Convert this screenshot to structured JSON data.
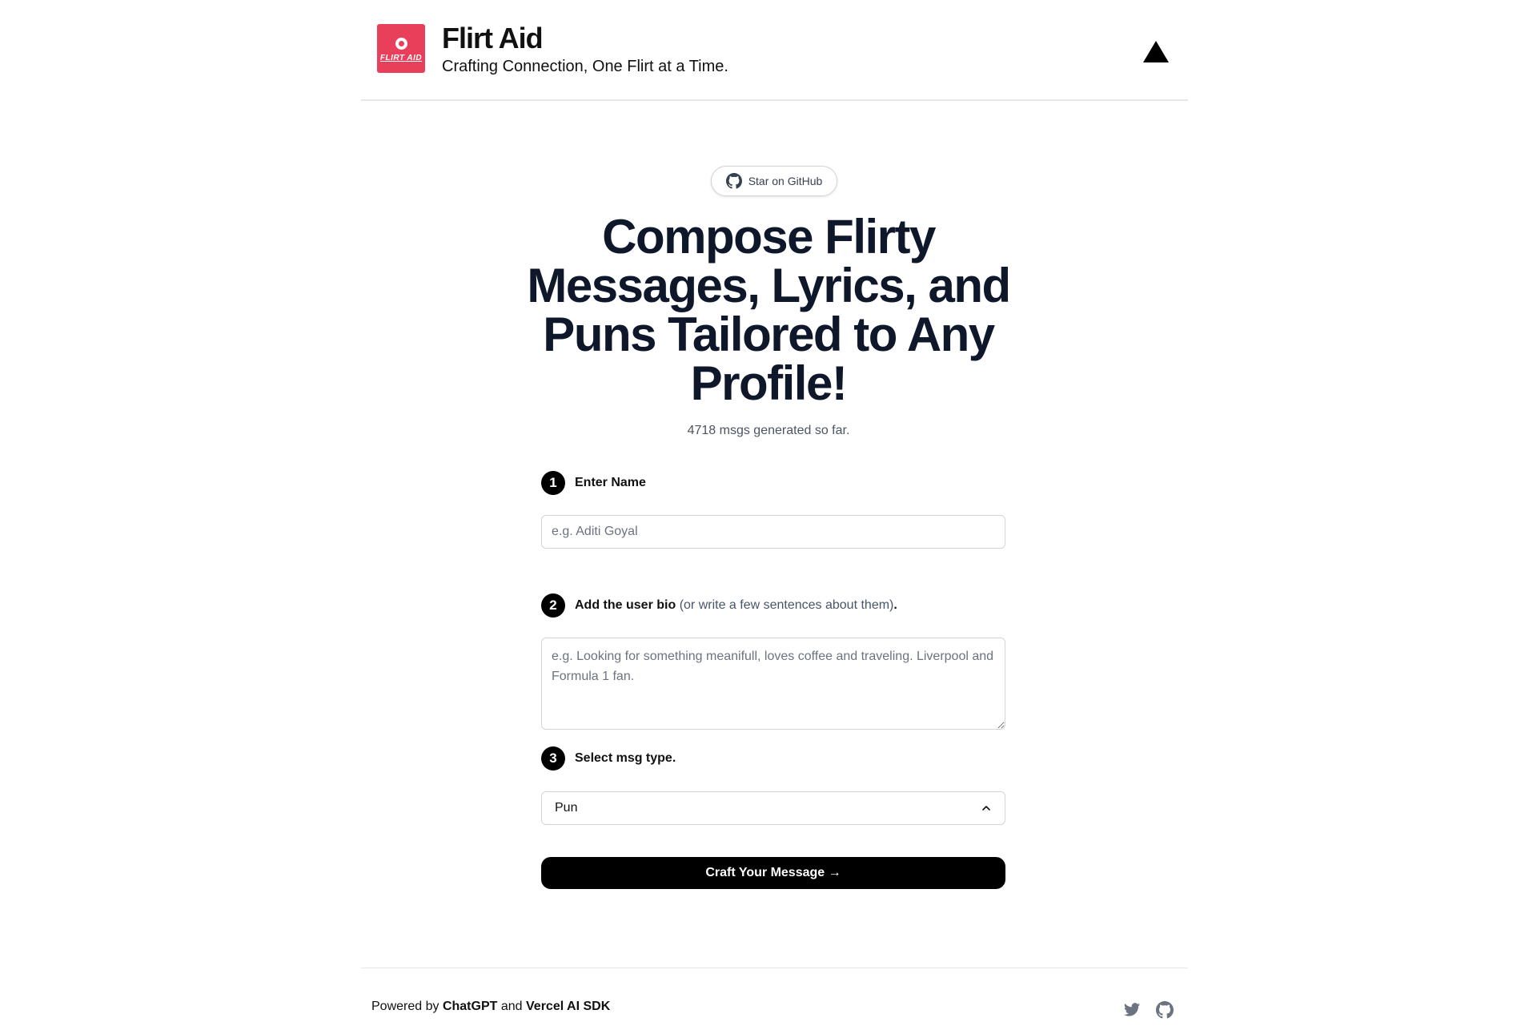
{
  "header": {
    "logo_text": "FLIRT AID",
    "title": "Flirt Aid",
    "subtitle": "Crafting Connection, One Flirt at a Time."
  },
  "github_star": {
    "label": "Star on GitHub"
  },
  "hero": {
    "title": "Compose Flirty Messages, Lyrics, and Puns Tailored to Any Profile!",
    "counter": "4718 msgs generated so far."
  },
  "steps": [
    {
      "number": "1",
      "label": "Enter Name"
    },
    {
      "number": "2",
      "label": "Add the user bio",
      "hint": "(or write a few sentences about them)",
      "suffix": "."
    },
    {
      "number": "3",
      "label": "Select msg type."
    }
  ],
  "name_input": {
    "placeholder": "e.g. Aditi Goyal",
    "value": ""
  },
  "bio_input": {
    "placeholder": "e.g. Looking for something meanifull, loves coffee and traveling. Liverpool and Formula 1 fan.",
    "value": ""
  },
  "msg_type_select": {
    "selected": "Pun"
  },
  "craft_button": {
    "label": "Craft Your Message →"
  },
  "footer": {
    "powered_prefix": "Powered by",
    "powered_brand1": "ChatGPT",
    "powered_and": "and",
    "powered_brand2": "Vercel AI SDK",
    "icons": [
      "twitter-icon",
      "github-icon"
    ]
  },
  "colors": {
    "brand": "#e8405a",
    "primary": "#000000",
    "muted": "#475569"
  }
}
